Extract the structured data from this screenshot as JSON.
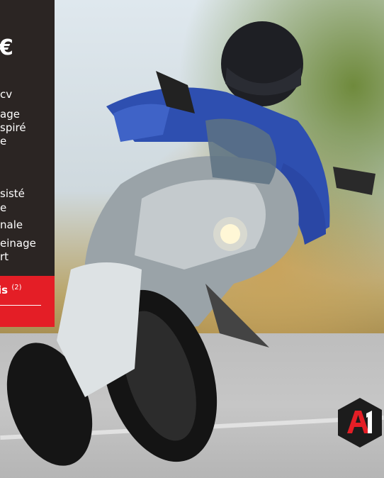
{
  "panel": {
    "price": "€",
    "features": [
      "cv",
      "age",
      "spiré",
      "e",
      "sisté",
      "e",
      "nale",
      "einage",
      "rt"
    ],
    "cta_label": "is",
    "cta_note": "(2)"
  },
  "badge": {
    "label": "A1",
    "accent": "#e41e26",
    "bg": "#1c1c1c"
  },
  "colors": {
    "panel_bg": "#2b2523",
    "cta_bg": "#e41e26"
  }
}
